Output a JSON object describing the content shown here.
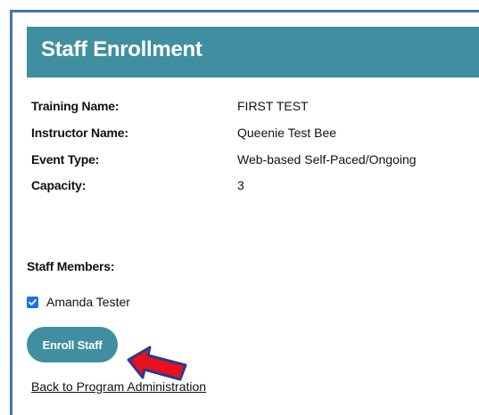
{
  "header": {
    "title": "Staff Enrollment"
  },
  "details": [
    {
      "label": "Training Name:",
      "value": "FIRST TEST"
    },
    {
      "label": "Instructor Name:",
      "value": "Queenie Test Bee"
    },
    {
      "label": "Event Type:",
      "value": "Web-based Self-Paced/Ongoing"
    },
    {
      "label": "Capacity:",
      "value": "3"
    }
  ],
  "staff": {
    "label": "Staff Members:",
    "members": [
      {
        "name": "Amanda Tester",
        "checked": true
      }
    ]
  },
  "actions": {
    "enroll_label": "Enroll Staff",
    "back_label": "Back to Program Administration"
  },
  "colors": {
    "header_bg": "#3f8fa1",
    "frame_border": "#4b73a8",
    "checkbox": "#1a73e8",
    "arrow_fill": "#e8101c",
    "arrow_outline": "#2b3a8f"
  },
  "icons": {
    "checkbox": "checkmark-icon",
    "annotation": "red-arrow-icon"
  }
}
